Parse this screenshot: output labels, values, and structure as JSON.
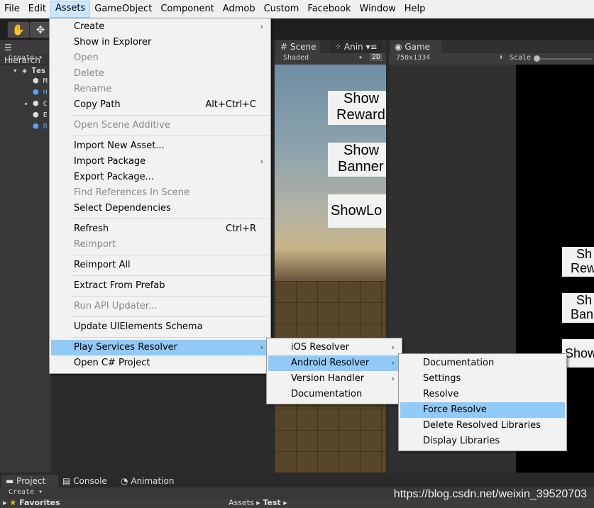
{
  "menubar": {
    "items": [
      "File",
      "Edit",
      "Assets",
      "GameObject",
      "Component",
      "Admob",
      "Custom",
      "Facebook",
      "Window",
      "Help"
    ]
  },
  "toolbar": {
    "hand_icon": "hand-icon",
    "move_icon": "move-icon"
  },
  "hierarchy": {
    "tab": "Hierarch",
    "create": "Create",
    "root": "Tes",
    "items": [
      "M",
      "H",
      "C",
      "E",
      "R"
    ]
  },
  "scene": {
    "tab_scene": "Scene",
    "tab_anim": "Anin",
    "shaded": "Shaded",
    "mode_2d": "2D",
    "buttons": [
      [
        "Show",
        "Reward"
      ],
      [
        "Show",
        "Banner"
      ],
      [
        "ShowLo"
      ]
    ]
  },
  "game": {
    "tab": "Game",
    "resolution": "750x1334",
    "scale": "Scale",
    "buttons": [
      [
        "Sh",
        "Rew"
      ],
      [
        "Sh",
        "Ban"
      ],
      [
        "Show"
      ]
    ]
  },
  "assets_menu": {
    "items": [
      {
        "label": "Create",
        "submenu": true
      },
      {
        "label": "Show in Explorer"
      },
      {
        "label": "Open",
        "disabled": true
      },
      {
        "label": "Delete",
        "disabled": true
      },
      {
        "label": "Rename",
        "disabled": true
      },
      {
        "label": "Copy Path",
        "shortcut": "Alt+Ctrl+C"
      },
      {
        "label": "Open Scene Additive",
        "disabled": true
      },
      {
        "label": "Import New Asset..."
      },
      {
        "label": "Import Package",
        "submenu": true
      },
      {
        "label": "Export Package..."
      },
      {
        "label": "Find References In Scene",
        "disabled": true
      },
      {
        "label": "Select Dependencies"
      },
      {
        "label": "Refresh",
        "shortcut": "Ctrl+R"
      },
      {
        "label": "Reimport",
        "disabled": true
      },
      {
        "label": "Reimport All"
      },
      {
        "label": "Extract From Prefab"
      },
      {
        "label": "Run API Updater...",
        "disabled": true
      },
      {
        "label": "Update UIElements Schema"
      },
      {
        "label": "Play Services Resolver",
        "submenu": true,
        "highlighted": true
      },
      {
        "label": "Open C# Project"
      }
    ]
  },
  "resolver_menu": {
    "items": [
      {
        "label": "iOS Resolver",
        "submenu": true
      },
      {
        "label": "Android Resolver",
        "submenu": true,
        "highlighted": true
      },
      {
        "label": "Version Handler",
        "submenu": true
      },
      {
        "label": "Documentation"
      }
    ]
  },
  "android_menu": {
    "items": [
      {
        "label": "Documentation"
      },
      {
        "label": "Settings"
      },
      {
        "label": "Resolve"
      },
      {
        "label": "Force Resolve",
        "highlighted": true
      },
      {
        "label": "Delete Resolved Libraries"
      },
      {
        "label": "Display Libraries"
      }
    ]
  },
  "bottom": {
    "tabs": [
      "Project",
      "Console",
      "Animation"
    ],
    "create": "Create",
    "favorites": "Favorites",
    "breadcrumb": [
      "Assets",
      "Test"
    ]
  },
  "watermark": "https://blog.csdn.net/weixin_39520703"
}
